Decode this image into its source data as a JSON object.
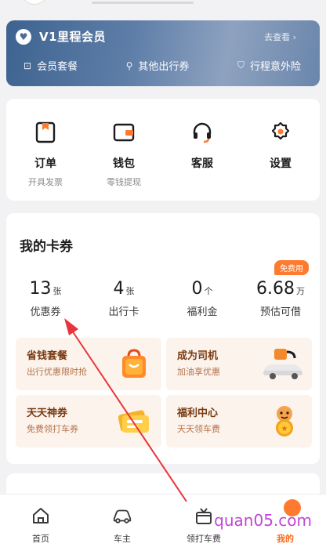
{
  "member": {
    "title": "V1里程会员",
    "more": "去查看",
    "items": [
      "会员套餐",
      "其他出行券",
      "行程意外险"
    ]
  },
  "services": [
    {
      "label": "订单",
      "sub": "开具发票",
      "icon": "order-icon"
    },
    {
      "label": "钱包",
      "sub": "零钱提现",
      "icon": "wallet-icon"
    },
    {
      "label": "客服",
      "sub": "",
      "icon": "headset-icon"
    },
    {
      "label": "设置",
      "sub": "",
      "icon": "gear-icon"
    }
  ],
  "coupons": {
    "title": "我的卡券",
    "badge": "免费用",
    "stats": [
      {
        "num": "13",
        "unit": "张",
        "label": "优惠券"
      },
      {
        "num": "4",
        "unit": "张",
        "label": "出行卡"
      },
      {
        "num": "0",
        "unit": "个",
        "label": "福利金"
      },
      {
        "num": "6.68",
        "unit": "万",
        "label": "预估可借"
      }
    ],
    "tiles": [
      {
        "title": "省钱套餐",
        "sub": "出行优惠限时抢",
        "art": "shopping-bag-icon"
      },
      {
        "title": "成为司机",
        "sub": "加油享优惠",
        "art": "car-fuel-icon"
      },
      {
        "title": "天天神券",
        "sub": "免费领打车券",
        "art": "ticket-icon"
      },
      {
        "title": "福利中心",
        "sub": "天天领车费",
        "art": "tiger-coin-icon"
      }
    ]
  },
  "tabs": [
    {
      "label": "首页",
      "icon": "home-icon"
    },
    {
      "label": "车主",
      "icon": "car-icon"
    },
    {
      "label": "领打车费",
      "icon": "gift-icon"
    },
    {
      "label": "我的",
      "icon": "profile-icon"
    }
  ],
  "watermark": "quan05.com",
  "colors": {
    "accent": "#ff6a1a",
    "member_bg": "#4f719c",
    "tile_bg": "#fbf3ec",
    "arrow": "#e8343a"
  }
}
